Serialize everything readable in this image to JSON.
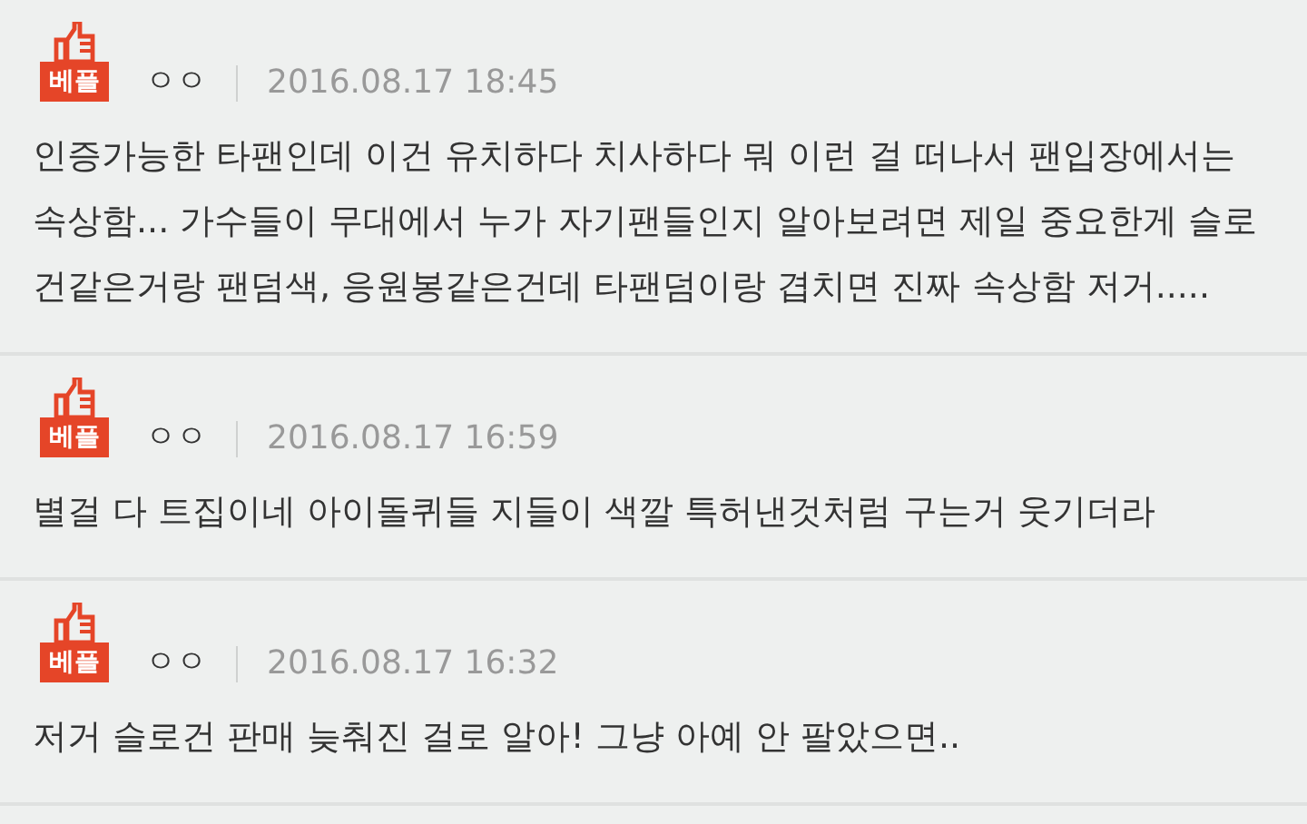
{
  "comments": [
    {
      "badge": "베플",
      "user": "ㅇㅇ",
      "date": "2016.08.17 18:45",
      "text": "인증가능한 타팬인데 이건 유치하다 치사하다 뭐 이런 걸 떠나서 팬입장에서는 속상함... 가수들이 무대에서 누가 자기팬들인지 알아보려면 제일 중요한게 슬로건같은거랑 팬덤색, 응원봉같은건데 타팬덤이랑 겹치면 진짜 속상함 저거....."
    },
    {
      "badge": "베플",
      "user": "ㅇㅇ",
      "date": "2016.08.17 16:59",
      "text": "별걸 다 트집이네 아이돌퀴들 지들이 색깔 특허낸것처럼 구는거 웃기더라"
    },
    {
      "badge": "베플",
      "user": "ㅇㅇ",
      "date": "2016.08.17 16:32",
      "text": "저거 슬로건 판매 늦춰진 걸로 알아! 그냥 아예 안 팔았으면.."
    }
  ]
}
